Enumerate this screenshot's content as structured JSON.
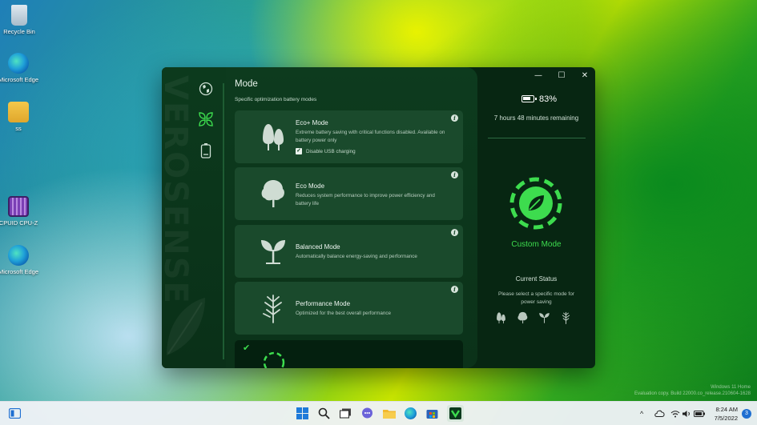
{
  "desktop": {
    "icons": [
      {
        "label": "Recycle Bin"
      },
      {
        "label": "Microsoft Edge"
      },
      {
        "label": "ss"
      },
      {
        "label": "CPUID CPU-Z"
      },
      {
        "label": "Microsoft Edge"
      }
    ],
    "os_watermark": [
      "Windows 11 Home",
      "Evaluation copy. Build 22000.co_release.210604-1628"
    ]
  },
  "app": {
    "watermark": "VEROSENSE",
    "rail": [
      {
        "icon": "globe-icon"
      },
      {
        "icon": "leaf-mode-icon",
        "active": true
      },
      {
        "icon": "battery-rail-icon"
      }
    ],
    "page": {
      "title": "Mode",
      "subtitle": "Specific optimization battery modes"
    },
    "modes": [
      {
        "name": "Eco+ Mode",
        "icon": "trees-icon",
        "description": "Extreme battery saving with critical functions disabled. Available on battery power only",
        "checkbox_label": "Disable USB charging",
        "checkbox_checked": true
      },
      {
        "name": "Eco Mode",
        "icon": "tree-icon",
        "description": "Reduces system performance to improve power efficiency and battery life"
      },
      {
        "name": "Balanced Mode",
        "icon": "sprout-icon",
        "description": "Automatically balance energy-saving and performance"
      },
      {
        "name": "Performance Mode",
        "icon": "branch-icon",
        "description": "Optimized for the best overall performance"
      }
    ],
    "info_glyph": "i",
    "custom_card": {
      "check_glyph": "✔"
    },
    "side": {
      "battery_percent": "83%",
      "battery_level": 0.83,
      "remaining": "7 hours 48 minutes remaining",
      "current_mode": "Custom Mode",
      "status_heading": "Current Status",
      "status_text": "Please select a specific mode for power saving",
      "window_controls": {
        "minimize": "—",
        "maximize": "☐",
        "close": "✕"
      }
    },
    "accent": "#3ddc4e",
    "background": "#072612"
  },
  "taskbar": {
    "clock_time": "8:24 AM",
    "clock_date": "7/5/2022",
    "notification_count": "3",
    "tray_chevron": "^"
  }
}
